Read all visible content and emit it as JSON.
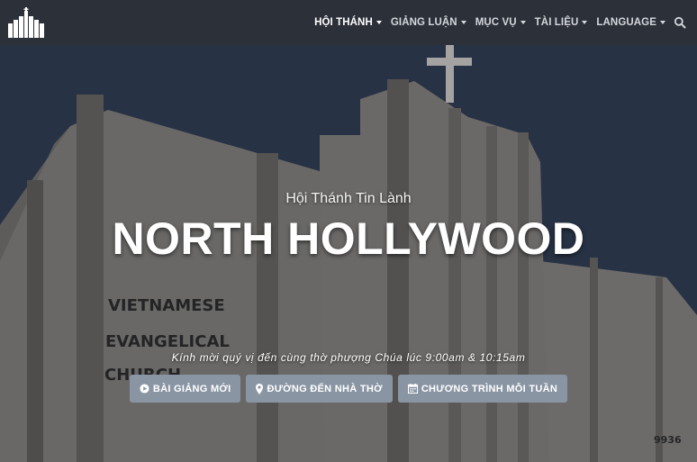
{
  "nav": {
    "items": [
      {
        "label": "HỘI THÁNH",
        "active": true
      },
      {
        "label": "GIẢNG LUẬN",
        "active": false
      },
      {
        "label": "MỤC VỤ",
        "active": false
      },
      {
        "label": "TÀI LIỆU",
        "active": false
      },
      {
        "label": "LANGUAGE",
        "active": false
      }
    ],
    "search_icon": "search-icon",
    "logo_icon": "church-logo"
  },
  "hero": {
    "subtitle": "Hội Thánh Tin Lành",
    "title": "NORTH HOLLYWOOD",
    "welcome": "Kính mời quý vị đến cùng thờ phượng Chúa lúc 9:00am & 10:15am",
    "building_sign": [
      "VIETNAMESE",
      "EVANGELICAL",
      "CHURCH"
    ],
    "address_number": "9936"
  },
  "buttons": [
    {
      "label": "BÀI GIẢNG MỚI",
      "icon": "play-circle-icon"
    },
    {
      "label": "ĐƯỜNG ĐẾN NHÀ THỜ",
      "icon": "map-marker-icon"
    },
    {
      "label": "CHƯƠNG TRÌNH MỖI TUẦN",
      "icon": "calendar-icon"
    }
  ]
}
